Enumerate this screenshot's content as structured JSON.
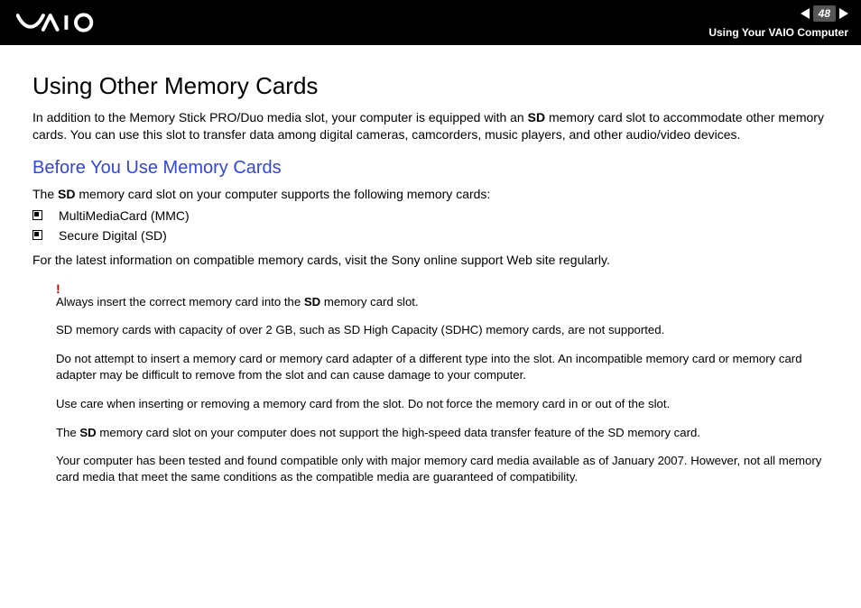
{
  "header": {
    "page_number": "48",
    "section_label": "Using Your VAIO Computer"
  },
  "content": {
    "title": "Using Other Memory Cards",
    "intro_pre": "In addition to the Memory Stick PRO/Duo media slot, your computer is equipped with an ",
    "intro_bold": "SD",
    "intro_post": " memory card slot to accommodate other memory cards. You can use this slot to transfer data among digital cameras, camcorders, music players, and other audio/video devices.",
    "subhead": "Before You Use Memory Cards",
    "supports_pre": "The ",
    "supports_bold": "SD",
    "supports_post": " memory card slot on your computer supports the following memory cards:",
    "bullets": [
      "MultiMediaCard (MMC)",
      "Secure Digital (SD)"
    ],
    "latest_info": "For the latest information on compatible memory cards, visit the Sony online support Web site regularly.",
    "exclaim": "!",
    "note1_pre": "Always insert the correct memory card into the ",
    "note1_bold": "SD",
    "note1_post": " memory card slot.",
    "note2": "SD memory cards with capacity of over 2 GB, such as SD High Capacity (SDHC) memory cards, are not supported.",
    "note3": "Do not attempt to insert a memory card or memory card adapter of a different type into the slot. An incompatible memory card or memory card adapter may be difficult to remove from the slot and can cause damage to your computer.",
    "note4": "Use care when inserting or removing a memory card from the slot. Do not force the memory card in or out of the slot.",
    "note5_pre": "The ",
    "note5_bold": "SD",
    "note5_post": " memory card slot on your computer does not support the high-speed data transfer feature of the SD memory card.",
    "note6": "Your computer has been tested and found compatible only with major memory card media available as of January 2007. However, not all memory card media that meet the same conditions as the compatible media are guaranteed of compatibility."
  }
}
